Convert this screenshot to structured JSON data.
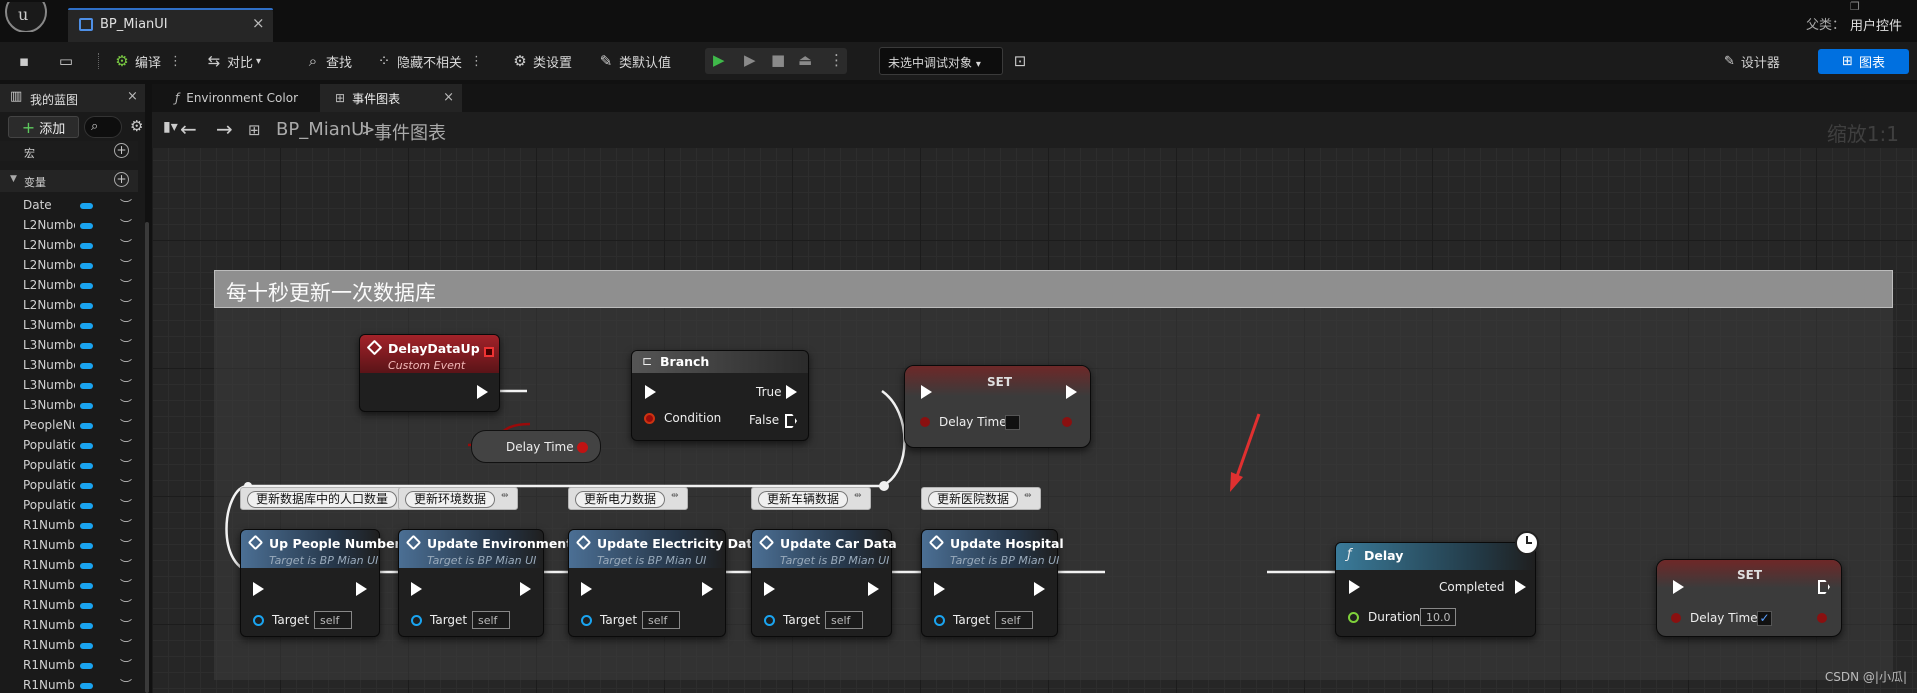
{
  "document_tab": {
    "label": "BP_MianUI",
    "close": "×"
  },
  "parent": {
    "label": "父类：",
    "value": "用户控件"
  },
  "toolbar": {
    "compile": "编译",
    "diff": "对比",
    "find": "查找",
    "hide_unrelated": "隐藏不相关",
    "class_settings": "类设置",
    "class_defaults": "类默认值",
    "debug_target": "未选中调试对象",
    "designer": "设计器",
    "graph": "图表"
  },
  "left_panel": {
    "tab": "我的蓝图",
    "close": "×",
    "add": "添加",
    "macro_section": "宏",
    "variables_section": "变量",
    "variables": [
      "Date",
      "L2Numbe",
      "L2Numbe",
      "L2Numbe",
      "L2Numbe",
      "L2Numbe",
      "L3Numbe",
      "L3Numbe",
      "L3Numbe",
      "L3Numbe",
      "L3Numbe",
      "PeopleNu",
      "Populatio",
      "Populatio",
      "Populatio",
      "Populatio",
      "R1Numbe",
      "R1Numbe",
      "R1Numbe",
      "R1Numbe",
      "R1Numbe",
      "R1Numbe",
      "R1Numbe",
      "R1Numbe",
      "R1Numbe"
    ]
  },
  "editor_tabs": [
    {
      "label": "Environment Color"
    },
    {
      "label": "事件图表",
      "close": "×"
    }
  ],
  "breadcrumb": {
    "blueprint": "BP_MianUI",
    "separator": ">",
    "graph": "事件图表"
  },
  "zoom": "缩放1:1",
  "comment": {
    "title": "每十秒更新一次数据库"
  },
  "nodes": {
    "event": {
      "title": "DelayDataUp",
      "subtitle": "Custom Event"
    },
    "branch": {
      "title": "Branch",
      "condition": "Condition",
      "true_label": "True",
      "false_label": "False"
    },
    "delay_time_get": {
      "label": "Delay Time"
    },
    "set1": {
      "title": "SET",
      "var": "Delay Time"
    },
    "calls": [
      {
        "title": "Up People Number",
        "subtitle": "Target is BP Mian UI",
        "target": "Target",
        "value": "self",
        "comment": "更新数据库中的人口数量"
      },
      {
        "title": "Update Environment",
        "subtitle": "Target is BP Mian UI",
        "target": "Target",
        "value": "self",
        "comment": "更新环境数据"
      },
      {
        "title": "Update Electricity Data",
        "subtitle": "Target is BP Mian UI",
        "target": "Target",
        "value": "self",
        "comment": "更新电力数据"
      },
      {
        "title": "Update Car Data",
        "subtitle": "Target is BP Mian UI",
        "target": "Target",
        "value": "self",
        "comment": "更新车辆数据"
      },
      {
        "title": "Update Hospital",
        "subtitle": "Target is BP Mian UI",
        "target": "Target",
        "value": "self",
        "comment": "更新医院数据"
      }
    ],
    "delay": {
      "title": "Delay",
      "completed": "Completed",
      "duration_label": "Duration",
      "duration": "10.0"
    },
    "set2": {
      "title": "SET",
      "var": "Delay Time"
    }
  },
  "watermark": "CSDN @|小瓜|"
}
